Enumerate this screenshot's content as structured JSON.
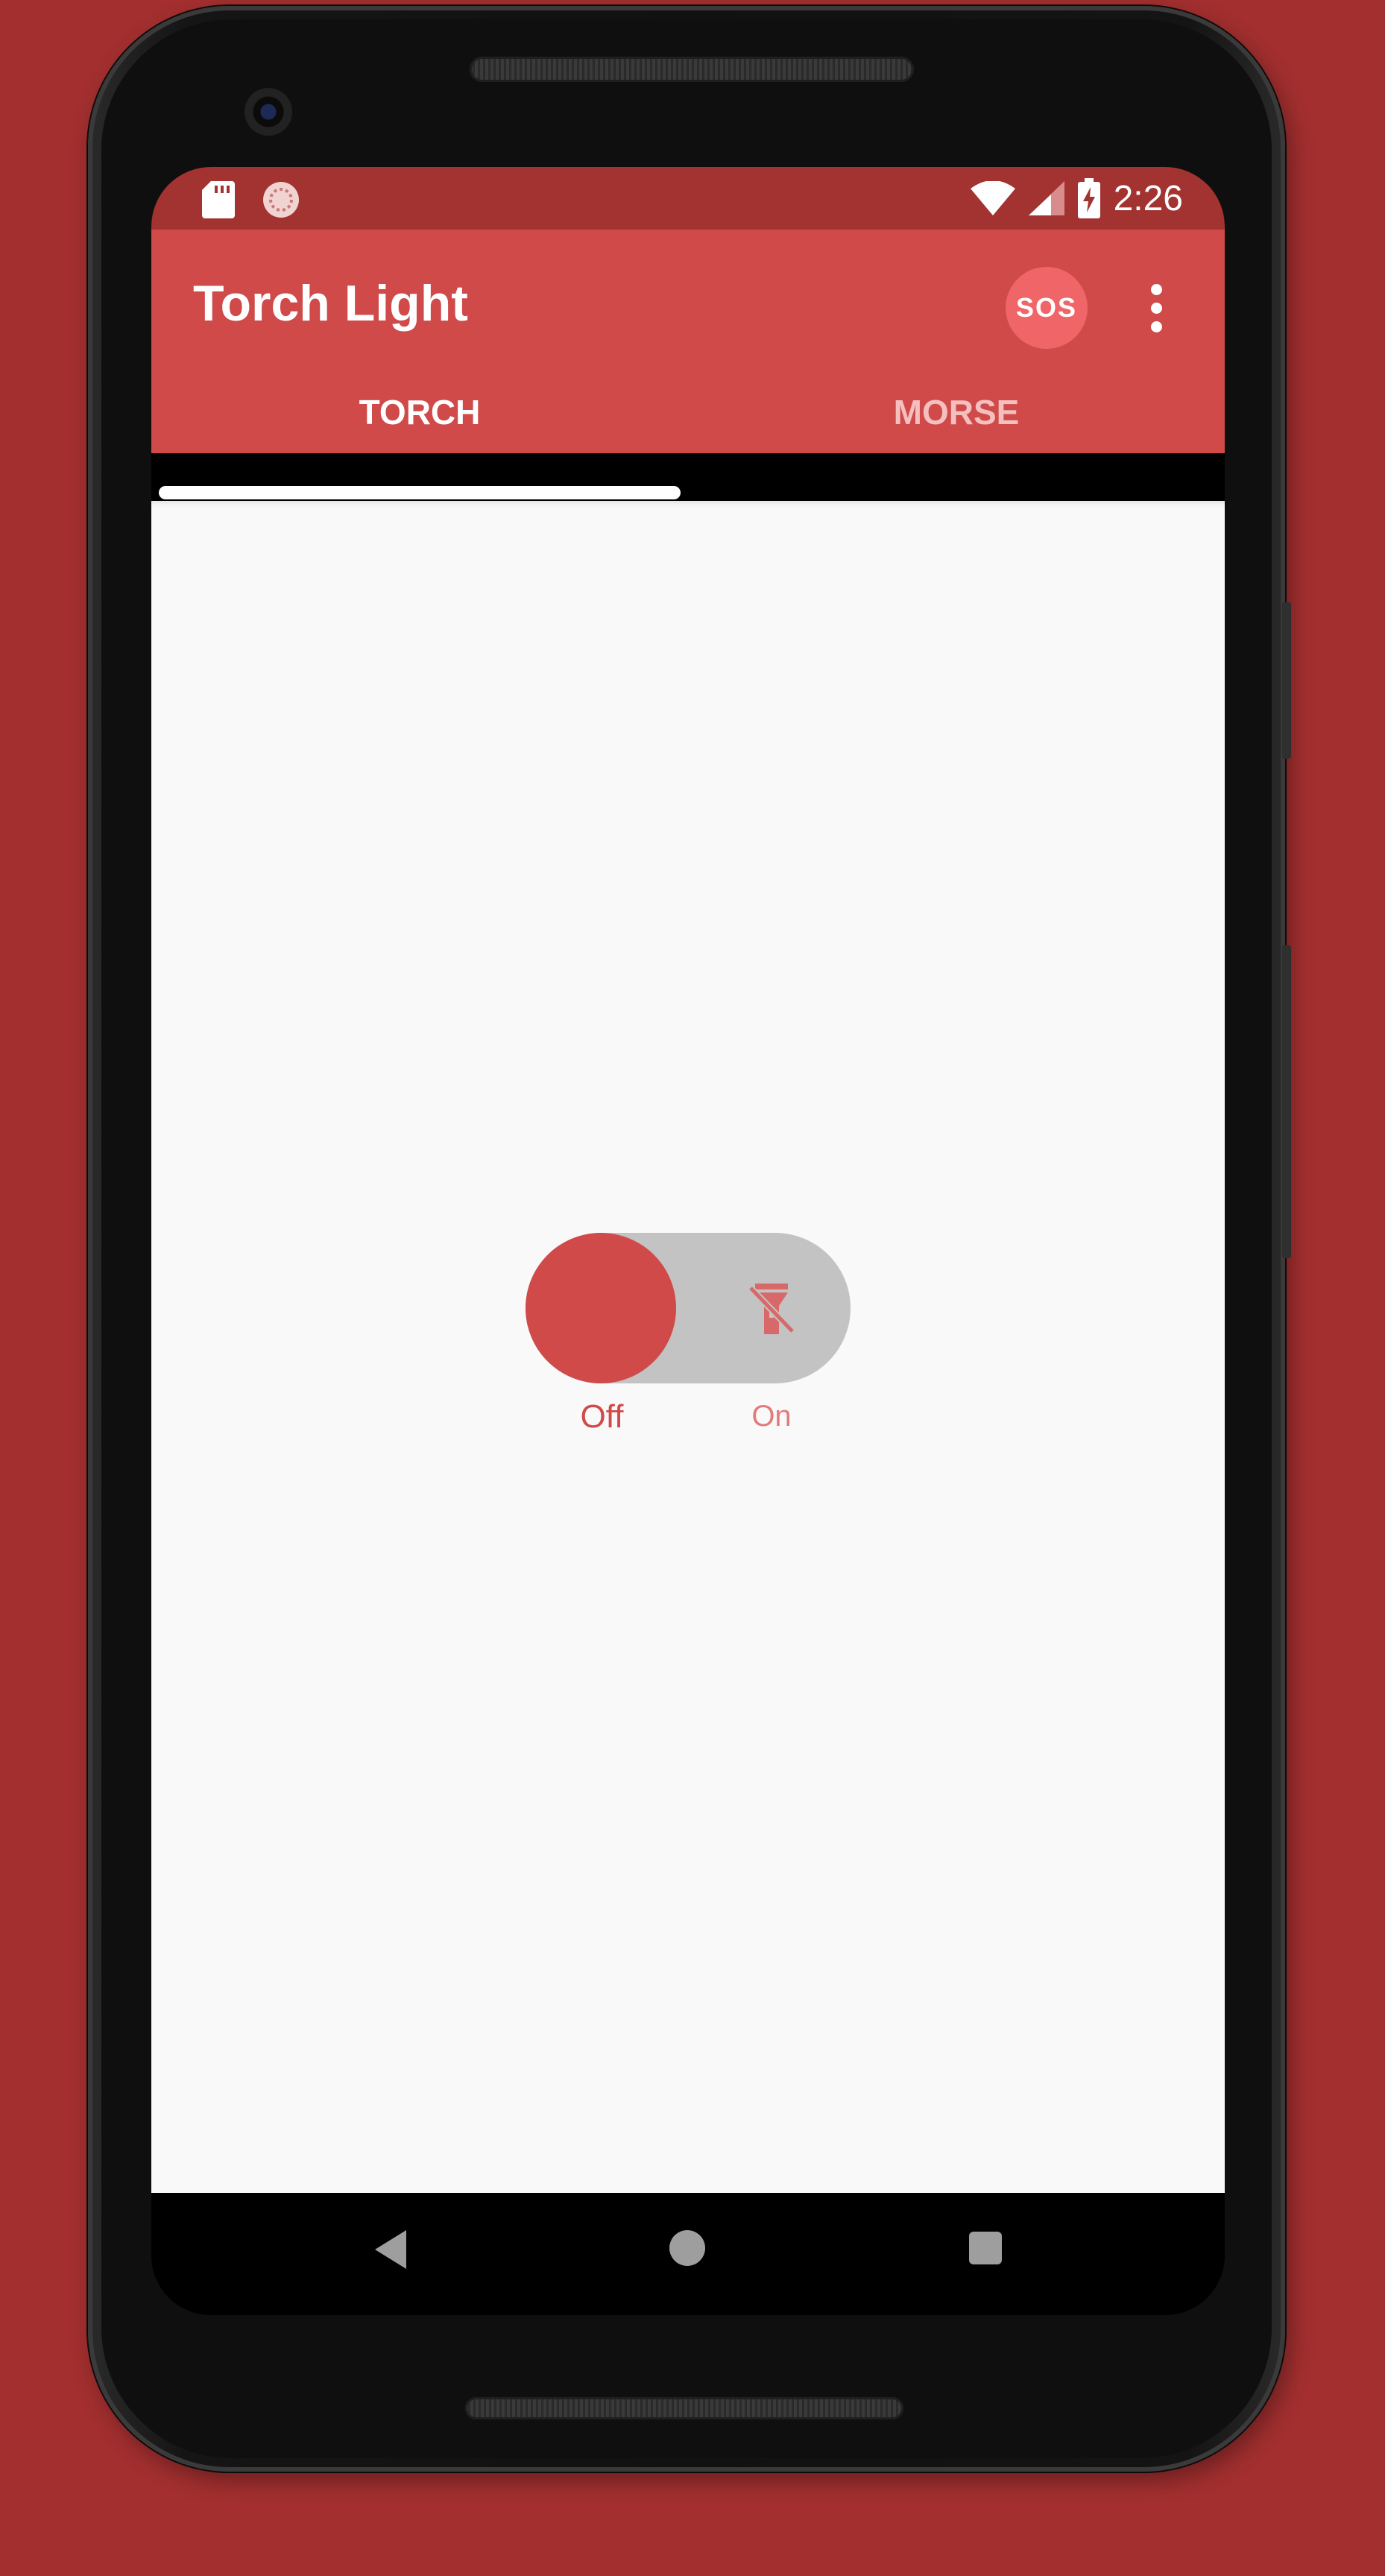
{
  "status_bar": {
    "time": "2:26",
    "left_icons": [
      "sd-card-icon",
      "sync-icon"
    ],
    "right_icons": [
      "wifi-icon",
      "cell-signal-icon",
      "battery-charging-icon"
    ]
  },
  "toolbar": {
    "title": "Torch Light",
    "sos_label": "SOS",
    "more_icon": "more-vert-icon"
  },
  "tabs": [
    {
      "label": "TORCH",
      "selected": true
    },
    {
      "label": "MORSE",
      "selected": false
    }
  ],
  "torch_toggle": {
    "state": "off",
    "off_label": "Off",
    "on_label": "On",
    "icon": "flashlight-off-icon"
  },
  "nav_bar": {
    "back": "back-icon",
    "home": "home-icon",
    "recents": "recents-icon"
  },
  "colors": {
    "background": "#a32f2f",
    "primary": "#cf4a49",
    "primary_dark": "#a23331",
    "sos_button": "#f06567",
    "track": "#c3c3c3",
    "content_bg": "#f9f9f9"
  }
}
